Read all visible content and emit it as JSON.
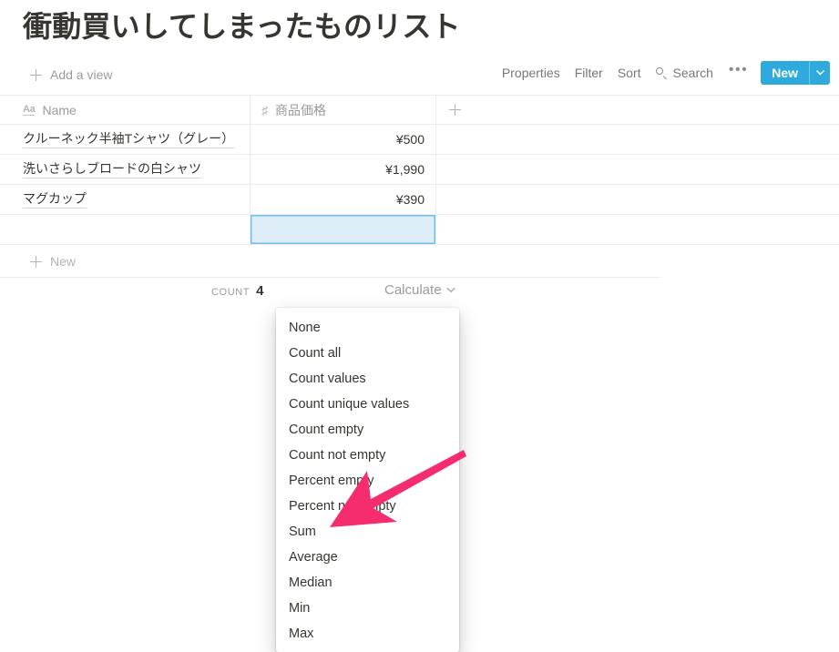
{
  "page": {
    "title": "衝動買いしてしまったものリスト"
  },
  "view_bar": {
    "add_view_label": "Add a view",
    "add_view_icon": "plus-icon",
    "toolbar": {
      "properties_label": "Properties",
      "filter_label": "Filter",
      "sort_label": "Sort",
      "search_label": "Search",
      "search_icon": "search-icon",
      "more_label": "•••",
      "more_icon": "ellipsis-icon",
      "new_label": "New",
      "new_caret_icon": "chevron-down-icon",
      "new_button_color": "#2eaadc"
    }
  },
  "table": {
    "columns": [
      {
        "label": "Name",
        "type_icon": "text-aa-icon",
        "icon_text": "Aa"
      },
      {
        "label": "商品価格",
        "type_icon": "number-hash-icon",
        "icon_text": "#"
      }
    ],
    "add_column_icon": "plus-icon",
    "rows": [
      {
        "name": "クルーネック半袖Tシャツ（グレー）",
        "price": "¥500"
      },
      {
        "name": "洗いさらしブロードの白シャツ",
        "price": "¥1,990"
      },
      {
        "name": "マグカップ",
        "price": "¥390"
      },
      {
        "name": "",
        "price": ""
      }
    ],
    "selected_cell": {
      "row_index": 3,
      "column": "商品価格"
    },
    "selection_fill": "#ddeef9",
    "selection_border": "#6fbfe8",
    "new_row_label": "New",
    "new_row_icon": "plus-icon"
  },
  "footer": {
    "count_label": "Count",
    "count_value": "4",
    "calculate_label": "Calculate",
    "calculate_caret_icon": "chevron-down-icon"
  },
  "menu": {
    "items": [
      "None",
      "Count all",
      "Count values",
      "Count unique values",
      "Count empty",
      "Count not empty",
      "Percent empty",
      "Percent not empty",
      "Sum",
      "Average",
      "Median",
      "Min",
      "Max"
    ]
  },
  "annotation": {
    "arrow_icon": "arrow-pointer-icon",
    "arrow_color": "#f52c6e",
    "points_at": "Sum"
  }
}
